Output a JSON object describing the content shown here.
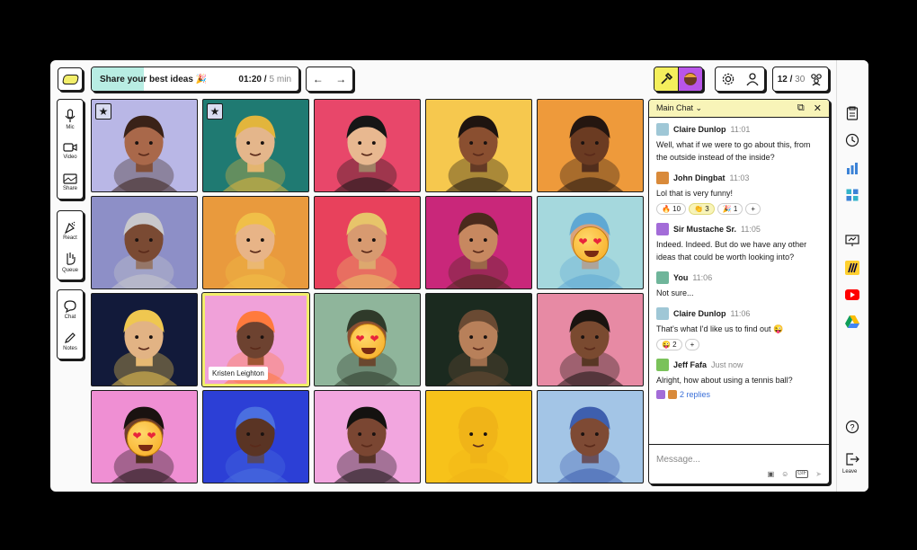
{
  "topic": {
    "title": "Share your best ideas 🎉",
    "elapsed": "01:20 /",
    "limit": "5 min",
    "progress": 0.25
  },
  "header": {
    "participants_current": "12 /",
    "participants_total": "30"
  },
  "left_toolbar": {
    "mic": "Mic",
    "video": "Video",
    "share": "Share",
    "react": "React",
    "queue": "Queue",
    "chat": "Chat",
    "notes": "Notes"
  },
  "grid": {
    "tiles": [
      {
        "bg": "#b9b7e6",
        "skin": "#a9684a",
        "hair": "#3a2218",
        "star": true
      },
      {
        "bg": "#1f7a72",
        "skin": "#e4b68b",
        "hair": "#e2b53c",
        "star": true
      },
      {
        "bg": "#e8476a",
        "skin": "#e8b890",
        "hair": "#161616"
      },
      {
        "bg": "#f6c84e",
        "skin": "#8a4f30",
        "hair": "#1e1410"
      },
      {
        "bg": "#ee9a3b",
        "skin": "#6b3b22",
        "hair": "#241610"
      },
      {
        "bg": "#8d8fc7",
        "skin": "#7a4a33",
        "hair": "#c8c8cc"
      },
      {
        "bg": "#e99a3d",
        "skin": "#e8b487",
        "hair": "#f0bf48"
      },
      {
        "bg": "#e8415c",
        "skin": "#d89a70",
        "hair": "#e7c46a"
      },
      {
        "bg": "#c9277a",
        "skin": "#c78860",
        "hair": "#4a2a1c"
      },
      {
        "bg": "#a5d8dd",
        "skin": "#d9a27b",
        "hair": "#5fa8d3",
        "emoji": true
      },
      {
        "bg": "#121a3a",
        "skin": "#e2b384",
        "hair": "#efc750"
      },
      {
        "bg": "#f0a1d9",
        "skin": "#6d4230",
        "hair": "#ff7a3d",
        "highlight": true,
        "name": "Kristen Leighton"
      },
      {
        "bg": "#8fb59b",
        "skin": "#8a5032",
        "hair": "#2f3a2a",
        "emoji": true
      },
      {
        "bg": "#1b2a1f",
        "skin": "#b8805a",
        "hair": "#6a4a33"
      },
      {
        "bg": "#e78aa4",
        "skin": "#7a4a30",
        "hair": "#1a1410"
      },
      {
        "bg": "#ef8fd3",
        "skin": "#6e3f2a",
        "hair": "#1a1210",
        "emoji": true
      },
      {
        "bg": "#2c3fd6",
        "skin": "#5a3424",
        "hair": "#4a6fe0"
      },
      {
        "bg": "#f2a6df",
        "skin": "#7a4632",
        "hair": "#141210"
      },
      {
        "bg": "#f7c21a",
        "skin": "#f0b418",
        "hair": "#f0b418"
      },
      {
        "bg": "#a3c5e6",
        "skin": "#7e4a34",
        "hair": "#3e5fae"
      }
    ]
  },
  "chat": {
    "title": "Main Chat",
    "chevron": "⌄",
    "placeholder": "Message...",
    "gif_label": "GIF",
    "messages": [
      {
        "author": "Claire Dunlop",
        "time": "11:01",
        "avatar": "#9fc7d6",
        "body": "Well, what if we were to go about this, from the outside instead of the inside?",
        "reactions": []
      },
      {
        "author": "John Dingbat",
        "time": "11:03",
        "avatar": "#d98a3a",
        "body": "Lol that is very funny!",
        "reactions": [
          {
            "label": "🔥 10",
            "on": false
          },
          {
            "label": "👏 3",
            "on": true
          },
          {
            "label": "🎉 1",
            "on": false
          },
          {
            "label": "+",
            "on": false
          }
        ]
      },
      {
        "author": "Sir Mustache Sr.",
        "time": "11:05",
        "avatar": "#a36cd8",
        "body": "Indeed. Indeed. But do we have any other ideas that could be worth looking into?",
        "reactions": []
      },
      {
        "author": "You",
        "time": "11:06",
        "avatar": "#6fb59a",
        "body": "Not sure...",
        "reactions": []
      },
      {
        "author": "Claire Dunlop",
        "time": "11:06",
        "avatar": "#9fc7d6",
        "body": "That's what I'd like us to find out 😜",
        "reactions": [
          {
            "label": "😜 2",
            "on": false
          },
          {
            "label": "+",
            "on": false
          }
        ]
      },
      {
        "author": "Jeff Fafa",
        "time": "Just now",
        "avatar": "#7ac25a",
        "body": "Alright, how about using a tennis ball?",
        "reactions": [],
        "replies": "2 replies"
      }
    ]
  },
  "rail": {
    "leave": "Leave"
  }
}
